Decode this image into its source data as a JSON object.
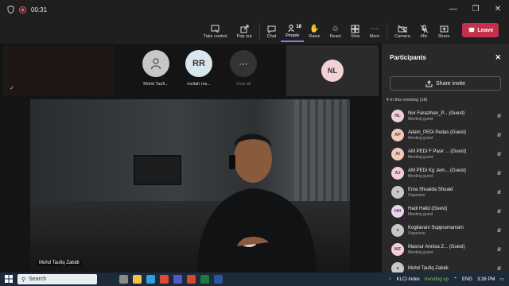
{
  "titlebar": {
    "timer": "00:31"
  },
  "toolbar": {
    "take_control": "Take control",
    "pop_out": "Pop out",
    "chat": "Chat",
    "people": "People",
    "people_count": "18",
    "raise": "Raise",
    "react": "React",
    "view": "View",
    "more": "More",
    "camera": "Camera",
    "mic": "Mic",
    "share": "Share",
    "leave": "Leave"
  },
  "stage": {
    "tiles": [
      {
        "name": "Mohd Taufi...",
        "initials": "",
        "color": "#c7c7c7"
      },
      {
        "name": "rozilah ros...",
        "initials": "RR",
        "color": "#d9e6ee"
      },
      {
        "name": "View all",
        "initials": "",
        "color": "#333333"
      }
    ],
    "nl_tile": {
      "initials": "NL",
      "color": "#f3d0d6"
    },
    "camera_name": "Mohd Taufiq Zabidi"
  },
  "panel": {
    "title": "Participants",
    "share_invite": "Share invite",
    "meeting_header": "In this meeting (18)",
    "participants": [
      {
        "initials": "NL",
        "name": "Nor Farazihan_P... (Guest)",
        "role": "Meeting guest",
        "color": "#f3d0d6"
      },
      {
        "initials": "AP",
        "name": "Adam_PEDi Pedas (Guest)",
        "role": "Meeting guest",
        "color": "#f5c9b8"
      },
      {
        "initials": "AI",
        "name": "AM PEDi F Pasir ... (Guest)",
        "role": "Meeting guest",
        "color": "#f5c9b8"
      },
      {
        "initials": "AJ",
        "name": "AM PEDi Kg Jem... (Guest)",
        "role": "Meeting guest",
        "color": "#f3d0d6"
      },
      {
        "initials": "",
        "name": "Ema Shuaida Shuaid",
        "role": "Organizer",
        "color": "#c7c7c7"
      },
      {
        "initials": "HH",
        "name": "Hadi Halid (Guest)",
        "role": "Meeting guest",
        "color": "#e9d3ee"
      },
      {
        "initials": "",
        "name": "Kogilavani Suppramaniam",
        "role": "Organizer",
        "color": "#c7c7c7"
      },
      {
        "initials": "MZ",
        "name": "Masnur Annisa Z... (Guest)",
        "role": "Meeting guest",
        "color": "#f3d0d6"
      },
      {
        "initials": "",
        "name": "Mohd Taufiq Zabidi",
        "role": "",
        "color": "#c7c7c7"
      }
    ]
  },
  "taskbar": {
    "search": "Search",
    "stock_name": "KLCI index",
    "stock_status": "trending up",
    "lang": "ENG",
    "time": "3:26 PM"
  }
}
